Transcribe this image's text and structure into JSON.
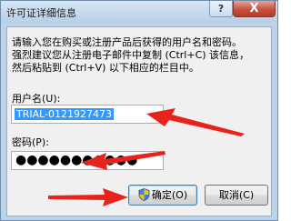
{
  "window": {
    "title": "许可证详细信息",
    "help_label": "?",
    "close_label": "X"
  },
  "instructions": {
    "line1": "请输入您在购买或注册产品后获得的用户名和密码。",
    "line2": "强烈建议您从注册电子邮件中复制 (Ctrl+C) 该信息，",
    "line3": "然后粘贴到 (Ctrl+V) 以下相应的栏目中。"
  },
  "username": {
    "label": "用户名(U):",
    "value": "TRIAL-0121927473"
  },
  "password": {
    "label": "密码(P):",
    "masked_value": "●●●●●●●●●●●"
  },
  "buttons": {
    "ok_label": "确定(O)",
    "cancel_label": "取消(C)"
  },
  "colors": {
    "annotation_arrow": "#e8231b",
    "selection": "#3399ff"
  },
  "icons": {
    "ok_button_icon": "uac-shield-icon"
  }
}
